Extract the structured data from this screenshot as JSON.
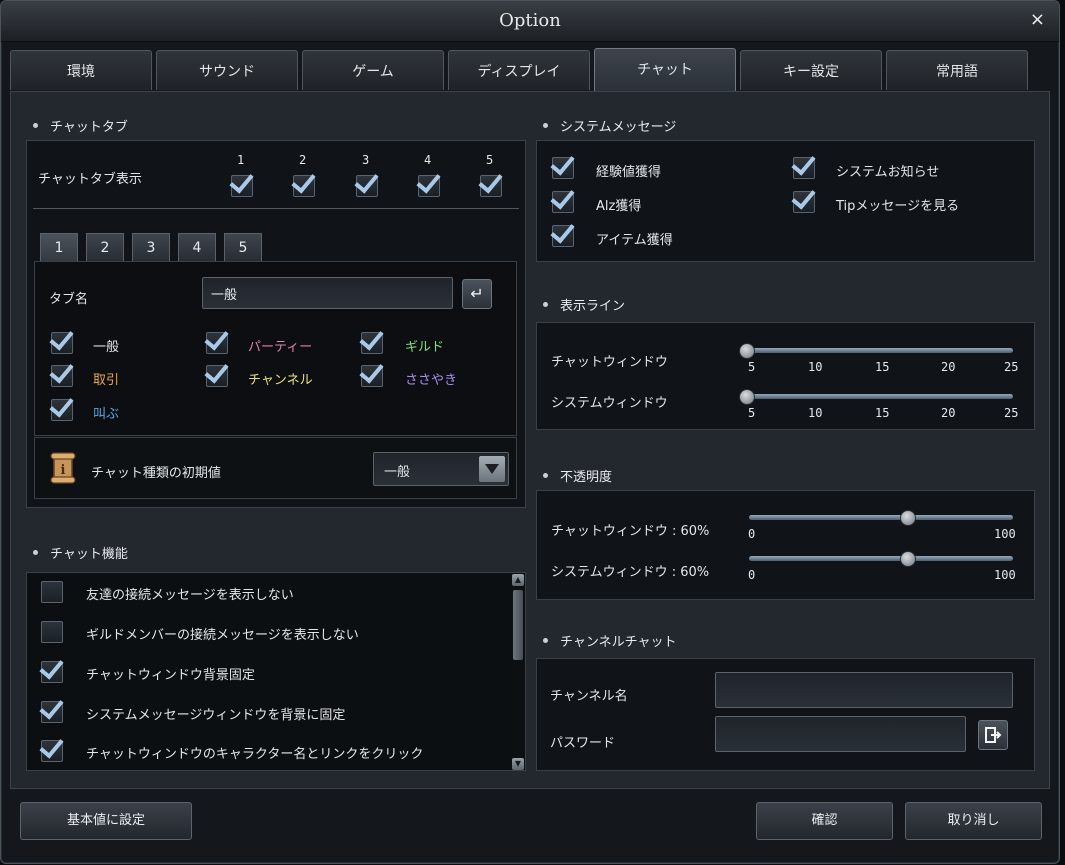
{
  "window": {
    "title": "Option",
    "close_label": "×"
  },
  "tabs": [
    {
      "label": "環境"
    },
    {
      "label": "サウンド"
    },
    {
      "label": "ゲーム"
    },
    {
      "label": "ディスプレイ"
    },
    {
      "label": "チャット",
      "active": true
    },
    {
      "label": "キー設定"
    },
    {
      "label": "常用語"
    }
  ],
  "chat_tab": {
    "title": "チャットタブ",
    "display_label": "チャットタブ表示",
    "display_numbers": [
      "1",
      "2",
      "3",
      "4",
      "5"
    ],
    "display_checked": [
      true,
      true,
      true,
      true,
      true
    ],
    "subtabs": [
      "1",
      "2",
      "3",
      "4",
      "5"
    ],
    "tab_name_label": "タブ名",
    "tab_name_value": "一般",
    "enter_icon": "enter-icon",
    "channels": [
      {
        "label": "一般",
        "color": "#e6e9ec",
        "checked": true
      },
      {
        "label": "パーティー",
        "color": "#e07fb0",
        "checked": true
      },
      {
        "label": "ギルド",
        "color": "#7fe07f",
        "checked": true
      },
      {
        "label": "取引",
        "color": "#e8a84a",
        "checked": true
      },
      {
        "label": "チャンネル",
        "color": "#e8e07a",
        "checked": true
      },
      {
        "label": "ささやき",
        "color": "#a88cf0",
        "checked": true
      },
      {
        "label": "叫ぶ",
        "color": "#5aa8e8",
        "checked": true
      }
    ],
    "default_type_label": "チャット種類の初期値",
    "default_type_value": "一般",
    "default_type_icon": "scroll-icon"
  },
  "chat_func": {
    "title": "チャット機能",
    "items": [
      {
        "label": "友達の接続メッセージを表示しない",
        "checked": false
      },
      {
        "label": "ギルドメンバーの接続メッセージを表示しない",
        "checked": false
      },
      {
        "label": "チャットウィンドウ背景固定",
        "checked": true
      },
      {
        "label": "システムメッセージウィンドウを背景に固定",
        "checked": true
      },
      {
        "label": "チャットウィンドウのキャラクター名とリンクをクリック",
        "checked": true
      }
    ]
  },
  "system_msg": {
    "title": "システムメッセージ",
    "items": [
      {
        "label": "経験値獲得",
        "checked": true
      },
      {
        "label": "システムお知らせ",
        "checked": true
      },
      {
        "label": "Alz獲得",
        "checked": true
      },
      {
        "label": "Tipメッセージを見る",
        "checked": true
      },
      {
        "label": "アイテム獲得",
        "checked": true
      }
    ]
  },
  "display_lines": {
    "title": "表示ライン",
    "scale": [
      "5",
      "10",
      "15",
      "20",
      "25"
    ],
    "sliders": [
      {
        "label": "チャットウィンドウ",
        "value": 5
      },
      {
        "label": "システムウィンドウ",
        "value": 5
      }
    ]
  },
  "opacity": {
    "title": "不透明度",
    "scale_min": "0",
    "scale_max": "100",
    "sliders": [
      {
        "label": "チャットウィンドウ : 60%",
        "value": 60
      },
      {
        "label": "システムウィンドウ : 60%",
        "value": 60
      }
    ]
  },
  "channel_chat": {
    "title": "チャンネルチャット",
    "name_label": "チャンネル名",
    "name_value": "",
    "password_label": "パスワード",
    "password_value": "",
    "enter_icon": "enter-door-icon"
  },
  "footer": {
    "default_button": "基本値に設定",
    "ok_button": "確認",
    "cancel_button": "取り消し"
  },
  "colors": {
    "accent_check": "#a9c9e8",
    "panel_bg": "#101317"
  }
}
